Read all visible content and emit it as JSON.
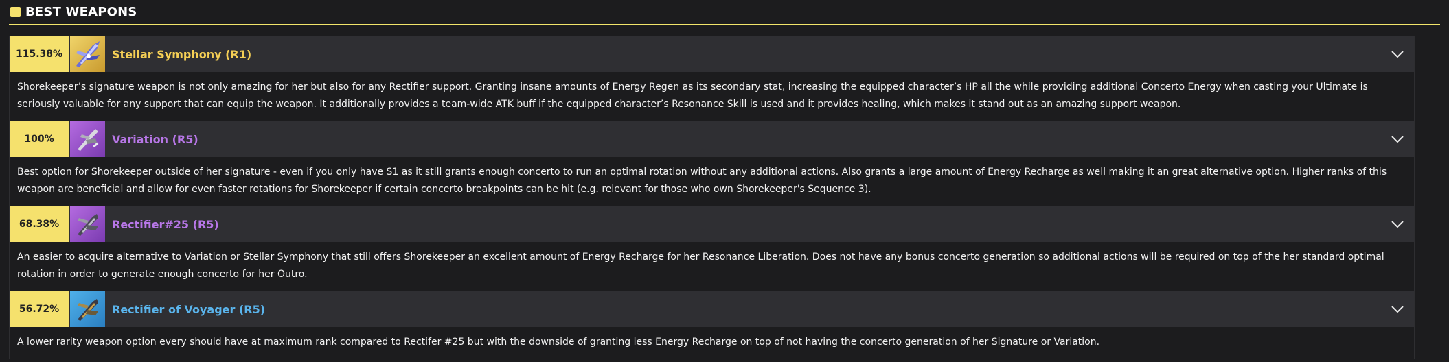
{
  "section": {
    "title": "BEST WEAPONS"
  },
  "weapons": [
    {
      "score": "115.38%",
      "name": "Stellar Symphony (R1)",
      "name_color": "#f5cf55",
      "icon": "stellar-symphony-weapon-icon",
      "description": "Shorekeeper’s signature weapon is not only amazing for her but also for any Rectifier support. Granting insane amounts of Energy Regen as its secondary stat, increasing the equipped character’s HP all the while providing additional Concerto Energy when casting your Ultimate is seriously valuable for any support that can equip the weapon. It additionally provides a team-wide ATK buff if the equipped character’s Resonance Skill is used and it provides healing, which makes it stand out as an amazing support weapon."
    },
    {
      "score": "100%",
      "name": "Variation (R5)",
      "name_color": "#b877e8",
      "icon": "variation-weapon-icon",
      "description": "Best option for Shorekeeper outside of her signature - even if you only have S1 as it still grants enough concerto to run an optimal rotation without any additional actions. Also grants a large amount of Energy Recharge as well making it an great alternative option. Higher ranks of this weapon are beneficial and allow for even faster rotations for Shorekeeper if certain concerto breakpoints can be hit (e.g. relevant for those who own Shorekeeper's Sequence 3)."
    },
    {
      "score": "68.38%",
      "name": "Rectifier#25 (R5)",
      "name_color": "#b877e8",
      "icon": "rectifier-25-weapon-icon",
      "description": "An easier to acquire alternative to Variation or Stellar Symphony that still offers Shorekeeper an excellent amount of Energy Recharge for her Resonance Liberation. Does not have any bonus concerto generation so additional actions will be required on top of the her standard optimal rotation in order to generate enough concerto for her Outro."
    },
    {
      "score": "56.72%",
      "name": "Rectifier of Voyager (R5)",
      "name_color": "#5ab4ec",
      "icon": "rectifier-of-voyager-weapon-icon",
      "description": "A lower rarity weapon option every should have at maximum rank compared to Rectifer #25 but with the downside of granting less Energy Recharge on top of not having the concerto generation of her Signature or Variation."
    }
  ]
}
